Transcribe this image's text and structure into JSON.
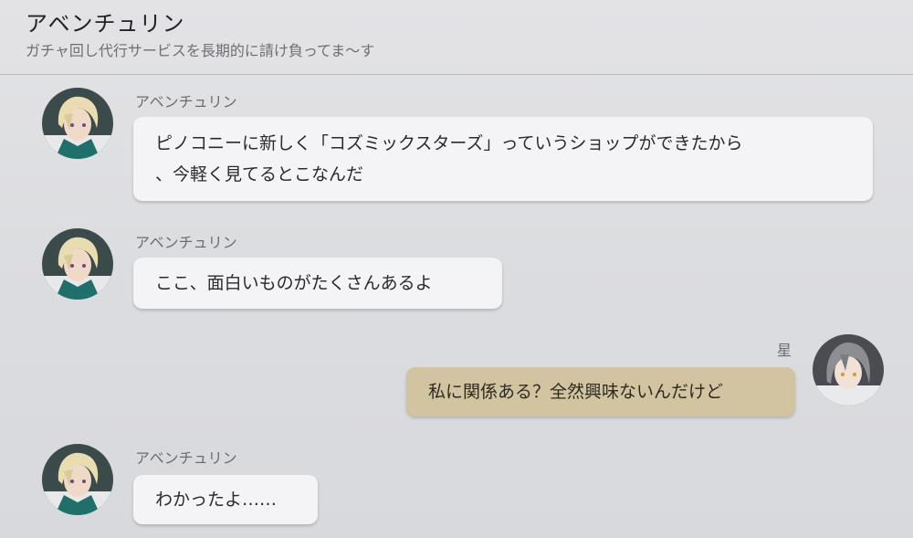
{
  "header": {
    "title": "アベンチュリン",
    "subtitle": "ガチャ回し代行サービスを長期的に請け負ってま〜す"
  },
  "messages": [
    {
      "sender": "アベンチュリン",
      "lines": [
        "ピノコニーに新しく「コズミックスターズ」っていうショップができたから",
        "、今軽く見てるとこなんだ"
      ]
    },
    {
      "sender": "アベンチュリン",
      "lines": [
        "ここ、面白いものがたくさんあるよ"
      ]
    },
    {
      "sender": "星",
      "lines": [
        "私に関係ある？全然興味ないんだけど"
      ]
    },
    {
      "sender": "アベンチュリン",
      "lines": [
        "わかったよ……"
      ]
    }
  ],
  "colors": {
    "background": "#dcdde0",
    "incoming_bubble": "#f4f4f6",
    "outgoing_bubble": "#d2c4a0"
  }
}
